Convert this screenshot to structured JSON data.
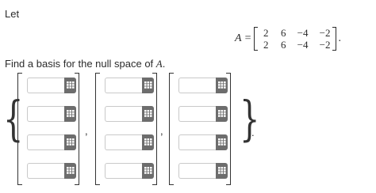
{
  "intro": "Let",
  "matrix": {
    "lhs": "A",
    "eq": "=",
    "rows": [
      [
        "2",
        "6",
        "−4",
        "−2"
      ],
      [
        "2",
        "6",
        "−4",
        "−2"
      ]
    ],
    "period": "."
  },
  "question": {
    "prefix": "Find a basis for the null space of ",
    "var": "A",
    "suffix": "."
  },
  "braces": {
    "left": "{",
    "right": "}",
    "end": "."
  },
  "separators": [
    ",",
    ","
  ],
  "vectors": [
    {
      "entries": [
        "",
        "",
        "",
        ""
      ]
    },
    {
      "entries": [
        "",
        "",
        "",
        ""
      ]
    },
    {
      "entries": [
        "",
        "",
        "",
        ""
      ]
    }
  ],
  "icons": {
    "keypad": "keypad-icon"
  },
  "colors": {
    "keypad_button": "#6d6d6d",
    "input_border": "#c9c9c9"
  }
}
